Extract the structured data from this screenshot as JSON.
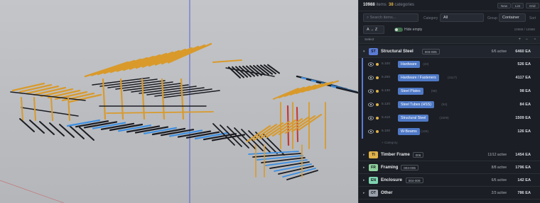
{
  "header": {
    "total_items": "10988",
    "items_label": "items",
    "categories_count": "38",
    "categories_label": "categories",
    "btn_new": "New",
    "btn_list": "List",
    "btn_grid": "Grid"
  },
  "filters": {
    "search_placeholder": "Search items...",
    "category_label": "Category",
    "category_value": "All",
    "group_label": "Group",
    "group_value": "Container",
    "sort_label": "Sort",
    "sort_value": "A → Z",
    "hide_empty_label": "Hide empty",
    "count_display": "10988 / 10988"
  },
  "select_bar": {
    "label": "Select",
    "expand_icon": "+",
    "collapse_icon": "−",
    "up_icon": "^"
  },
  "groups": [
    {
      "badge": "ST",
      "badge_color": "#5b7bd6",
      "name": "Structural Steel",
      "range": "003-005",
      "active": "6/6 active",
      "qty": "6460 EA",
      "expanded": true,
      "items": [
        {
          "code": "5.100",
          "tag": "Hardware",
          "note": "(23)",
          "qty": "526 EA"
        },
        {
          "code": "5.200",
          "tag": "Hardware / Fasteners",
          "note": "(4117)",
          "qty": "4117 EA"
        },
        {
          "code": "5.130",
          "tag": "Steel Plates",
          "note": "(98)",
          "qty": "98 EA"
        },
        {
          "code": "5.120",
          "tag": "Steel Tubes (HSS)",
          "note": "(84)",
          "qty": "84 EA"
        },
        {
          "code": "5.410",
          "tag": "Structural Steel",
          "note": "(1509)",
          "qty": "1509 EA"
        },
        {
          "code": "5.100",
          "tag": "W-Beams",
          "note": "(126)",
          "qty": "126 EA"
        }
      ],
      "footer": "+ Category"
    },
    {
      "badge": "TI",
      "badge_color": "#e0b34a",
      "name": "Timber Frame",
      "range": "006",
      "active": "11/12 active",
      "qty": "1454 EA",
      "expanded": false
    },
    {
      "badge": "FR",
      "badge_color": "#8fd19e",
      "name": "Framing",
      "range": "003-006",
      "active": "8/8 active",
      "qty": "1796 EA",
      "expanded": false
    },
    {
      "badge": "EN",
      "badge_color": "#7fd3b0",
      "name": "Enclosure",
      "range": "004-009",
      "active": "6/6 active",
      "qty": "142 EA",
      "expanded": false
    },
    {
      "badge": "OT",
      "badge_color": "#9aa0aa",
      "name": "Other",
      "range": "",
      "active": "2/3 active",
      "qty": "786 EA",
      "expanded": false
    }
  ]
}
